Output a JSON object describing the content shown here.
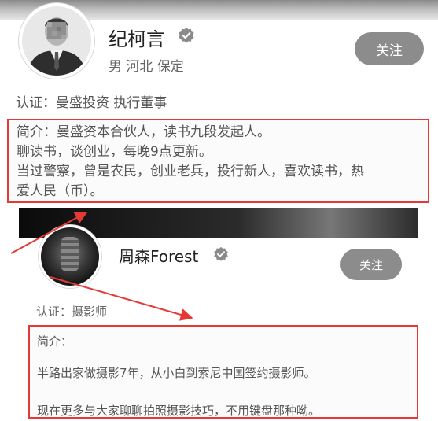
{
  "profile1": {
    "name": "纪柯言",
    "subtitle": "男  河北 保定",
    "follow_label": "关注",
    "certification": "认证：曼盛投资 执行董事",
    "bio_lines": [
      "简介：曼盛资本合伙人，读书九段发起人。",
      "聊读书，谈创业，每晚9点更新。",
      "当过警察，曾是农民，创业老兵，投行新人，喜欢读书，热",
      "爱人民（币）。"
    ]
  },
  "profile2": {
    "name": "周森Forest",
    "follow_label": "关注",
    "certification": "认证：摄影师",
    "bio_lines": [
      "简介：",
      "半路出家做摄影7年，从小白到索尼中国签约摄影师。",
      "现在更多与大家聊聊拍照摄影技巧，不用键盘那种呦。"
    ]
  },
  "icons": {
    "verified": "verified-badge-icon",
    "arrow": "annotation-arrow-icon"
  },
  "colors": {
    "highlight_border": "#e53935",
    "follow_button": "#8c8c8c",
    "arrow": "#e53935"
  }
}
